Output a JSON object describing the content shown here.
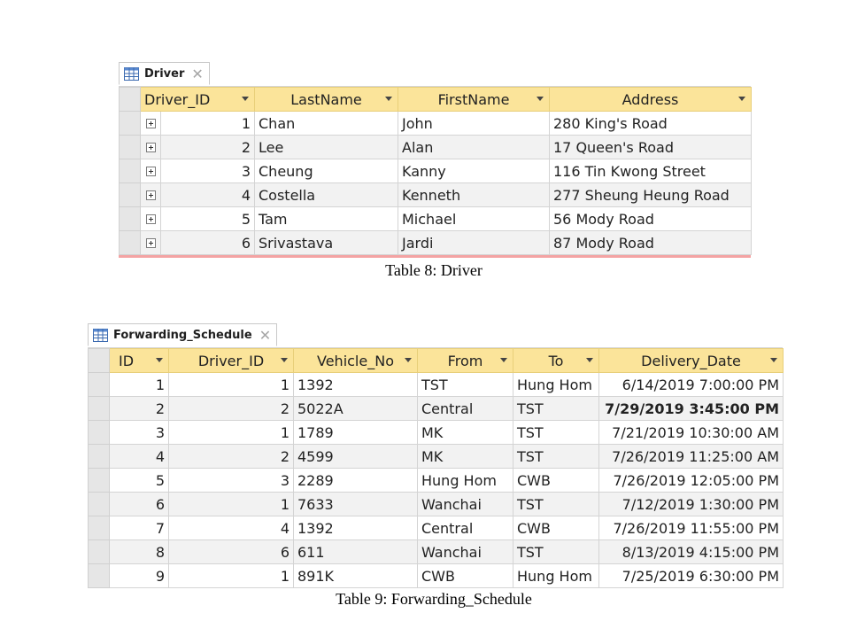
{
  "driver_table": {
    "tab_title": "Driver",
    "columns": [
      "Driver_ID",
      "LastName",
      "FirstName",
      "Address"
    ],
    "rows": [
      [
        "1",
        "Chan",
        "John",
        "280 King's Road"
      ],
      [
        "2",
        "Lee",
        "Alan",
        "17 Queen's Road"
      ],
      [
        "3",
        "Cheung",
        "Kanny",
        "116 Tin Kwong Street"
      ],
      [
        "4",
        "Costella",
        "Kenneth",
        "277 Sheung Heung Road"
      ],
      [
        "5",
        "Tam",
        "Michael",
        "56 Mody Road"
      ],
      [
        "6",
        "Srivastava",
        "Jardi",
        "87 Mody Road"
      ]
    ],
    "caption": "Table 8: Driver"
  },
  "schedule_table": {
    "tab_title": "Forwarding_Schedule",
    "columns": [
      "ID",
      "Driver_ID",
      "Vehicle_No",
      "From",
      "To",
      "Delivery_Date"
    ],
    "rows": [
      [
        "1",
        "1",
        "1392",
        "TST",
        "Hung Hom",
        "6/14/2019 7:00:00 PM"
      ],
      [
        "2",
        "2",
        "5022A",
        "Central",
        "TST",
        "7/29/2019 3:45:00 PM"
      ],
      [
        "3",
        "1",
        "1789",
        "MK",
        "TST",
        "7/21/2019 10:30:00 AM"
      ],
      [
        "4",
        "2",
        "4599",
        "MK",
        "TST",
        "7/26/2019 11:25:00 AM"
      ],
      [
        "5",
        "3",
        "2289",
        "Hung Hom",
        "CWB",
        "7/26/2019 12:05:00 PM"
      ],
      [
        "6",
        "1",
        "7633",
        "Wanchai",
        "TST",
        "7/12/2019 1:30:00 PM"
      ],
      [
        "7",
        "4",
        "1392",
        "Central",
        "CWB",
        "7/26/2019 11:55:00 PM"
      ],
      [
        "8",
        "6",
        "611",
        "Wanchai",
        "TST",
        "8/13/2019 4:15:00 PM"
      ],
      [
        "9",
        "1",
        "891K",
        "CWB",
        "Hung Hom",
        "7/25/2019 6:30:00 PM"
      ]
    ],
    "caption": "Table 9: Forwarding_Schedule"
  }
}
